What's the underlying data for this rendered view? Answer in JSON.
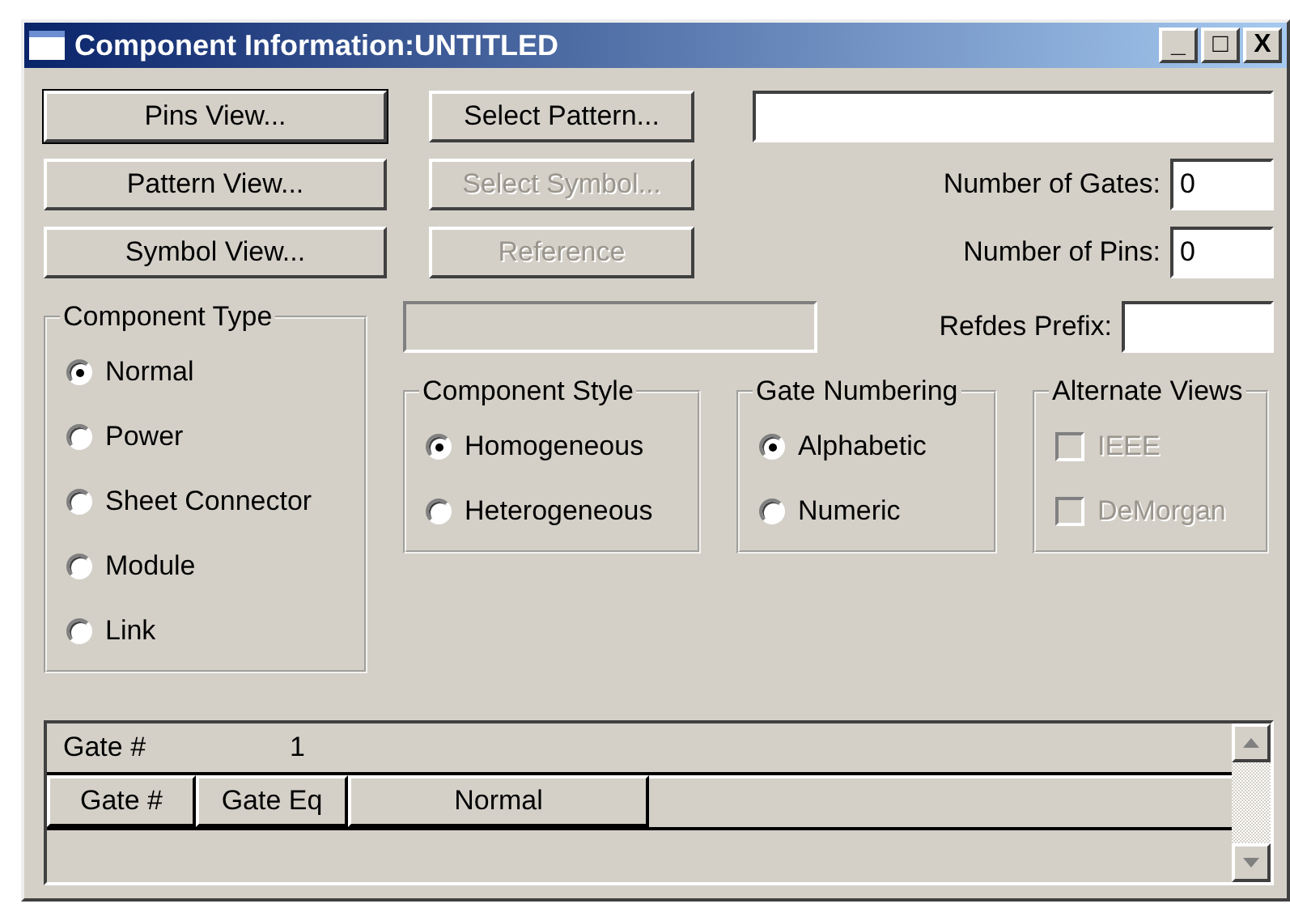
{
  "window": {
    "title": "Component Information:UNTITLED",
    "controls": [
      "_",
      "□",
      "X"
    ]
  },
  "view_buttons": [
    {
      "label": "Pins View...",
      "disabled": false,
      "default": true
    },
    {
      "label": "Pattern View...",
      "disabled": false,
      "default": false
    },
    {
      "label": "Symbol View...",
      "disabled": false,
      "default": false
    }
  ],
  "select_buttons": [
    {
      "label": "Select Pattern...",
      "disabled": false
    },
    {
      "label": "Select Symbol...",
      "disabled": true
    },
    {
      "label": "Reference",
      "disabled": true
    }
  ],
  "number_of_gates": {
    "label": "Number of Gates:",
    "value": "0"
  },
  "number_of_pins": {
    "label": "Number of Pins:",
    "value": "0"
  },
  "refdes_prefix": {
    "label": "Refdes Prefix:"
  },
  "component_type": {
    "title": "Component Type",
    "options": [
      {
        "label": "Normal",
        "selected": true
      },
      {
        "label": "Power",
        "selected": false
      },
      {
        "label": "Sheet Connector",
        "selected": false
      },
      {
        "label": "Module",
        "selected": false
      },
      {
        "label": "Link",
        "selected": false
      }
    ]
  },
  "component_style": {
    "title": "Component Style",
    "options": [
      {
        "label": "Homogeneous",
        "selected": true
      },
      {
        "label": "Heterogeneous",
        "selected": false
      }
    ]
  },
  "gate_numbering": {
    "title": "Gate Numbering",
    "options": [
      {
        "label": "Alphabetic",
        "selected": true
      },
      {
        "label": "Numeric",
        "selected": false
      }
    ]
  },
  "alternate_views": {
    "title": "Alternate Views",
    "options": [
      {
        "label": "IEEE",
        "checked": false,
        "disabled": true
      },
      {
        "label": "DeMorgan",
        "checked": false,
        "disabled": true
      }
    ]
  },
  "gate_grid": {
    "row_label": "Gate #",
    "row_value": "1",
    "columns": [
      "Gate #",
      "Gate Eq",
      "Normal"
    ]
  }
}
